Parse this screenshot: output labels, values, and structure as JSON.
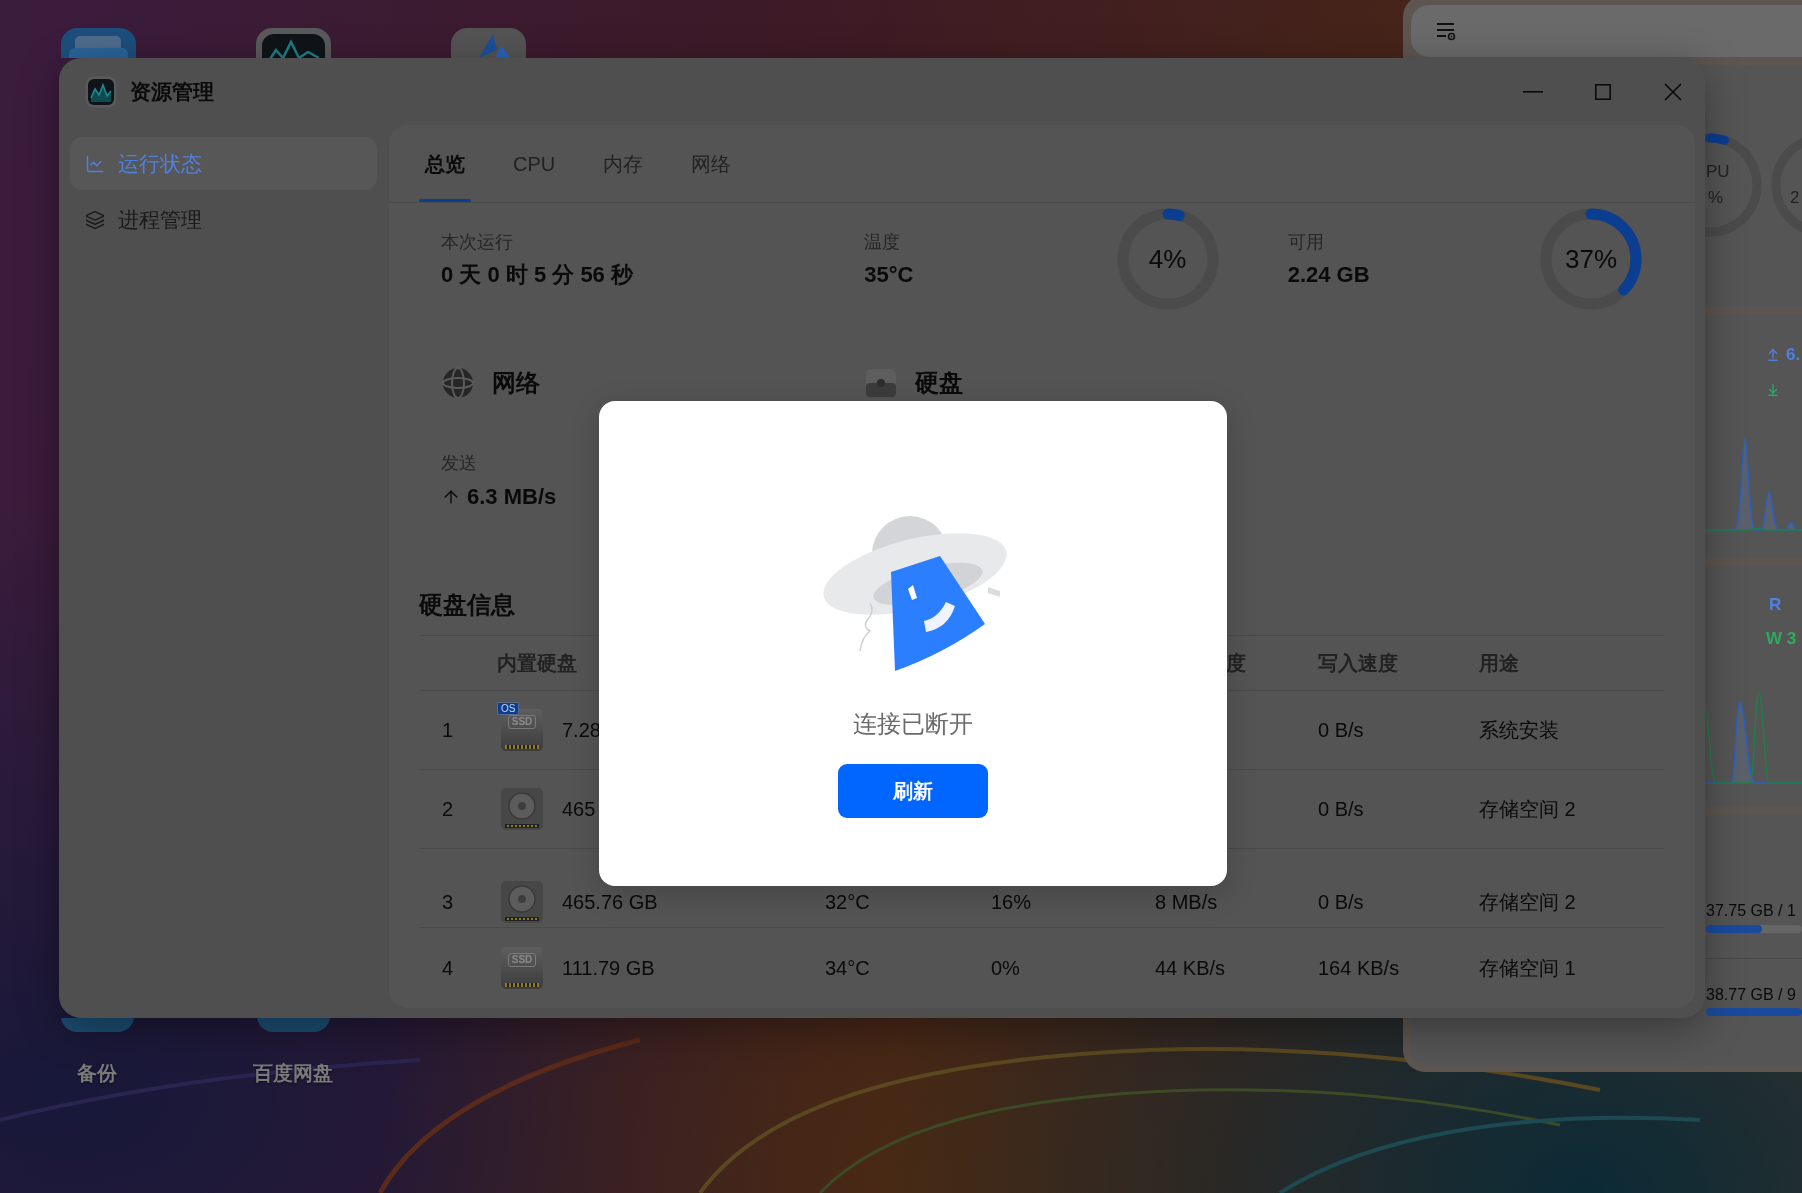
{
  "desktop": {
    "top_apps": [
      {
        "kind": "files"
      },
      {
        "kind": "monitor"
      },
      {
        "kind": "logo"
      }
    ],
    "bottom_apps": [
      {
        "label": "备份"
      },
      {
        "label": "百度网盘"
      }
    ]
  },
  "widget_panel": {
    "gauges": [
      {
        "name": "PU",
        "reading": "%",
        "level": 0.05
      },
      {
        "reading": "2"
      }
    ],
    "network": {
      "upload": "6."
    },
    "disk": {
      "read": "R",
      "write": "W 3"
    },
    "storage": [
      {
        "text": "37.75 GB / 1",
        "level": 0.58
      },
      {
        "text": "38.77 GB / 9",
        "level": 1
      }
    ]
  },
  "window": {
    "title": "资源管理"
  },
  "sidebar": {
    "items": [
      {
        "kind": "chart",
        "label": "运行状态",
        "selected": true
      },
      {
        "kind": "layers",
        "label": "进程管理",
        "selected": false
      }
    ]
  },
  "tabs": [
    {
      "label": "总览",
      "selected": true
    },
    {
      "label": "CPU",
      "selected": false
    },
    {
      "label": "内存",
      "selected": false
    },
    {
      "label": "网络",
      "selected": false
    }
  ],
  "summary_cards": [
    {
      "label": "本次运行",
      "value": "0 天 0 时 5 分 56 秒"
    },
    {
      "label": "温度",
      "value": "35°C",
      "gauge": {
        "reading": "4%",
        "level": 0.04
      }
    },
    {
      "label": "可用",
      "value": "2.24 GB",
      "gauge": {
        "reading": "37%",
        "level": 0.37
      }
    }
  ],
  "sections": [
    {
      "kind": "network",
      "title": "网络",
      "stats": [
        {
          "kind": "upload",
          "label": "发送",
          "value": "6.3 MB/s"
        }
      ]
    },
    {
      "kind": "disk",
      "title": "硬盘"
    }
  ],
  "disk_table": {
    "title": "硬盘信息",
    "header": {
      "column_2": "内置硬盘",
      "column_5": "度",
      "column_6": "写入速度",
      "column_7": "用途"
    },
    "rows": [
      {
        "column_1": "1",
        "kind": "ssd",
        "icon_text": "SSD",
        "badge": "OS",
        "column_2": "7.28",
        "column_6": "0 B/s",
        "column_7": "系统安装"
      },
      {
        "column_1": "2",
        "kind": "hdd",
        "column_2": "465",
        "column_6": "0 B/s",
        "column_7": "存储空间 2"
      },
      {
        "column_1": "3",
        "kind": "hdd",
        "column_2": "465.76 GB",
        "column_3": "32°C",
        "column_4": "16%",
        "column_5": "8 MB/s",
        "column_6": "0 B/s",
        "column_7": "存储空间 2"
      },
      {
        "column_1": "4",
        "kind": "ssd",
        "icon_text": "SSD",
        "column_2": "111.79 GB",
        "column_3": "34°C",
        "column_4": "0%",
        "column_5": "44 KB/s",
        "column_6": "164 KB/s",
        "column_7": "存储空间 1"
      }
    ]
  },
  "dialog": {
    "message": "连接已断开",
    "button": "刷新"
  }
}
